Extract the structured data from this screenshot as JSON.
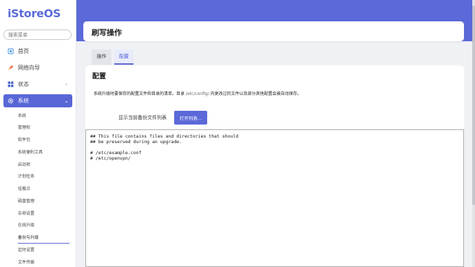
{
  "app": {
    "logo": "iStoreOS"
  },
  "sidebar": {
    "search_placeholder": "搜索菜单",
    "items": [
      {
        "label": "首页",
        "icon": "home-icon"
      },
      {
        "label": "网络向导",
        "icon": "rocket-icon"
      },
      {
        "label": "状态",
        "icon": "grid-icon"
      },
      {
        "label": "系统",
        "icon": "gear-icon"
      }
    ],
    "submenu": [
      "系统",
      "管理权",
      "软件包",
      "系统便利工具",
      "启动项",
      "计划任务",
      "挂载点",
      "磁盘管理",
      "杂项设置",
      "在线升级",
      "备份与升级",
      "定时设置",
      "文件传输"
    ],
    "active_sub": "备份与升级"
  },
  "header": {
    "title": "刷写操作"
  },
  "tabs": [
    {
      "label": "操作",
      "active": false
    },
    {
      "label": "配置",
      "active": true
    }
  ],
  "config": {
    "section_title": "配置",
    "description_pre": "系统升级时要保存的配置文件和目录的清单。目录 ",
    "description_path": "/etc/config/",
    "description_post": " 内更改过的文件以及部分其他配置会被自动保存。",
    "list_label": "显示当前备份文件列表",
    "open_button": "打开列表...",
    "editor_content": "## This file contains files and directories that should\n## be preserved during an upgrade.\n\n# /etc/example.conf\n# /etc/openvpn/"
  },
  "colors": {
    "accent": "#5b69d9",
    "background": "#f0f1f5"
  }
}
